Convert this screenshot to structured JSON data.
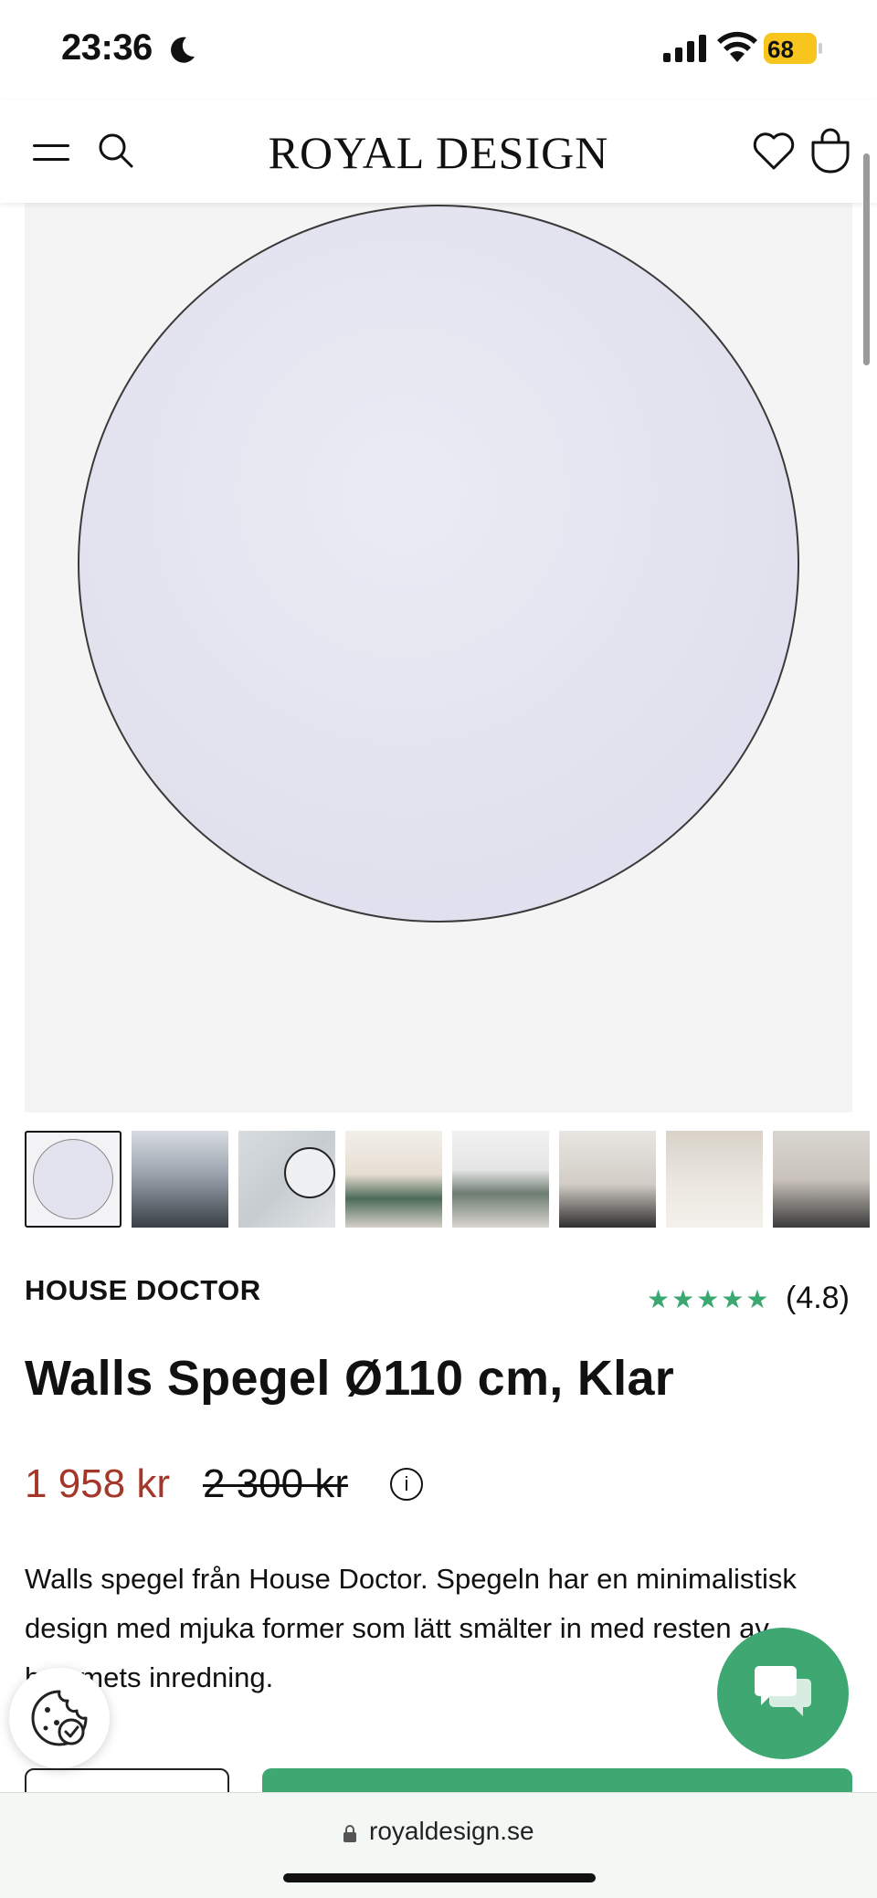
{
  "status_bar": {
    "time": "23:36",
    "battery": "68"
  },
  "header": {
    "logo": "ROYAL DESIGN"
  },
  "gallery": {
    "thumbnails": [
      "Walls Spegel – produktbild",
      "Spegel i vardagsrum med havsutsikt",
      "Spegel på marmorvägg",
      "Vardagsrum med grön soffa",
      "Vardagsrum med spegel",
      "Spegel i hall",
      "Sovrum med spegel",
      "Spegel med dekorationer"
    ]
  },
  "product": {
    "brand": "HOUSE DOCTOR",
    "rating_stars": "★★★★★",
    "rating_value": "(4.8)",
    "title": "Walls Spegel Ø110 cm, Klar",
    "price": "1 958 kr",
    "old_price": "2 300 kr",
    "info_symbol": "i",
    "description": "Walls spegel från House Doctor. Spegeln har en minimalistisk design med mjuka former som lätt smälter in med resten av hemmets inredning."
  },
  "browser": {
    "url": "royaldesign.se"
  },
  "colors": {
    "accent_green": "#3fa872",
    "sale_red": "#a4372a",
    "rating_green": "#3aa870"
  }
}
